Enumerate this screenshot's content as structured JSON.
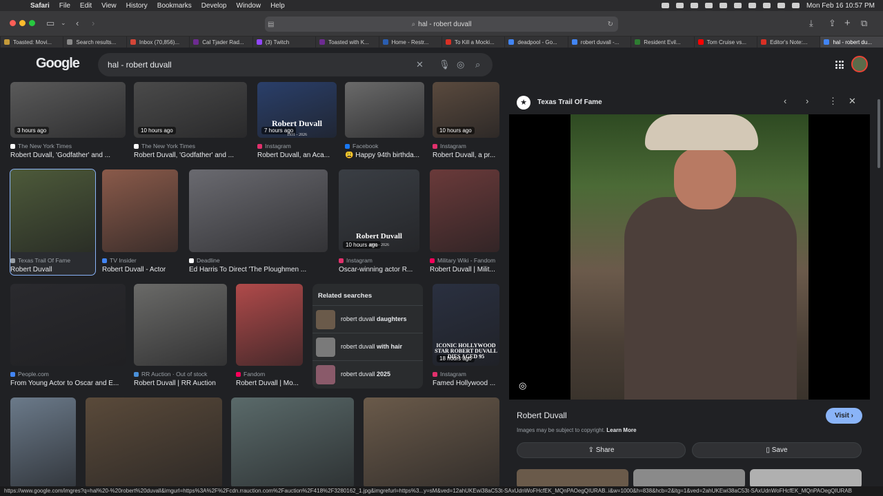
{
  "menubar": {
    "app": "Safari",
    "items": [
      "File",
      "Edit",
      "View",
      "History",
      "Bookmarks",
      "Develop",
      "Window",
      "Help"
    ],
    "datetime": "Mon Feb 16  10:57 PM"
  },
  "browser": {
    "url": "hal - robert duvall",
    "tabs": [
      {
        "label": "Toasted: Movi...",
        "color": "#c49a3a"
      },
      {
        "label": "Search results...",
        "color": "#888"
      },
      {
        "label": "Inbox (70,856)...",
        "color": "#d44638"
      },
      {
        "label": "Cal Tjader Rad...",
        "color": "#6d2b91"
      },
      {
        "label": "(3) Twitch",
        "color": "#9146ff"
      },
      {
        "label": "Toasted with K...",
        "color": "#6d2b91"
      },
      {
        "label": "Home - Restr...",
        "color": "#2a5db0"
      },
      {
        "label": "To Kill a Mocki...",
        "color": "#d93025"
      },
      {
        "label": "deadpool - Go...",
        "color": "#4285f4"
      },
      {
        "label": "robert duvall -...",
        "color": "#4285f4"
      },
      {
        "label": "Resident Evil...",
        "color": "#2e7d32"
      },
      {
        "label": "Tom Cruise vs...",
        "color": "#ff0000"
      },
      {
        "label": "Editor's Note:...",
        "color": "#d93025"
      },
      {
        "label": "hal - robert du...",
        "color": "#4285f4"
      }
    ]
  },
  "google": {
    "logo": "Google",
    "query": "hal - robert duvall"
  },
  "results": [
    {
      "src": "The New York Times",
      "title": "Robert Duvall, 'Godfather' and ...",
      "time": "3 hours ago",
      "color": "#5a5a5a",
      "fav": "#ffffff"
    },
    {
      "src": "The New York Times",
      "title": "Robert Duvall, 'Godfather' and ...",
      "time": "10 hours ago",
      "color": "#4a4a4a",
      "fav": "#ffffff"
    },
    {
      "src": "Instagram",
      "title": "Robert Duvall, an Aca...",
      "time": "7 hours ago",
      "color": "#2a3f6a",
      "fav": "#e1306c"
    },
    {
      "src": "Facebook",
      "title": "😩 Happy 94th birthda...",
      "time": "",
      "color": "#6a6a6a",
      "fav": "#1877f2"
    },
    {
      "src": "Instagram",
      "title": "Robert Duvall, a pr...",
      "time": "10 hours ago",
      "color": "#5a4a3e",
      "fav": "#e1306c"
    },
    {
      "src": "Texas Trail Of Fame",
      "title": "Robert Duvall",
      "time": "",
      "color": "#4d5a3a",
      "fav": "#9aa0a6"
    },
    {
      "src": "TV Insider",
      "title": "Robert Duvall - Actor",
      "time": "",
      "color": "#8a5a4a",
      "fav": "#4285f4"
    },
    {
      "src": "Deadline",
      "title": "Ed Harris To Direct 'The Ploughmen ...",
      "time": "",
      "color": "#6a6a70",
      "fav": "#ffffff"
    },
    {
      "src": "Instagram",
      "title": "Oscar-winning actor R...",
      "time": "10 hours ago",
      "color": "#3a3e44",
      "fav": "#e1306c"
    },
    {
      "src": "Military Wiki - Fandom",
      "title": "Robert Duvall | Milit...",
      "time": "",
      "color": "#6a3a3a",
      "fav": "#fa005a"
    },
    {
      "src": "People.com",
      "title": "From Young Actor to Oscar and E...",
      "time": "",
      "color": "#2a2a2e",
      "fav": "#4285f4"
    },
    {
      "src": "RR Auction · Out of stock",
      "title": "Robert Duvall | RR Auction",
      "time": "",
      "color": "#6a6a68",
      "fav": "#4a90d9"
    },
    {
      "src": "Fandom",
      "title": "Robert Duvall | Mo...",
      "time": "",
      "color": "#b04a4a",
      "fav": "#fa005a"
    },
    {
      "src": "Instagram",
      "title": "Famed Hollywood ...",
      "time": "18 hours ago",
      "color": "#2a3040",
      "fav": "#e1306c"
    },
    {
      "src": "",
      "title": "",
      "time": "",
      "color": "#6b7a8a",
      "fav": "#000"
    },
    {
      "src": "",
      "title": "",
      "time": "",
      "color": "#5a4a3a",
      "fav": "#000"
    },
    {
      "src": "",
      "title": "",
      "time": "",
      "color": "#5a6a6a",
      "fav": "#000"
    },
    {
      "src": "",
      "title": "",
      "time": "",
      "color": "#6a5a4a",
      "fav": "#000"
    }
  ],
  "overlay_texts": {
    "robert_duvall_1": "Robert Duvall",
    "year_1": "1931 - 2026",
    "robert_duvall_2": "Robert Duvall",
    "year_2": "1931 - 2026",
    "iconic": "ICONIC HOLLYWOOD STAR ROBERT DUVALL DIES AGED 95"
  },
  "related": {
    "heading": "Related searches",
    "items": [
      {
        "prefix": "robert duvall ",
        "bold": "daughters",
        "color": "#6a5a4a"
      },
      {
        "prefix": "robert duvall ",
        "bold": "with hair",
        "color": "#7a7a7a"
      },
      {
        "prefix": "robert duvall ",
        "bold": "2025",
        "color": "#8a5a6a"
      }
    ]
  },
  "panel": {
    "source": "Texas Trail Of Fame",
    "title": "Robert Duvall",
    "visit": "Visit",
    "copyright": "Images may be subject to copyright.",
    "learn_more": "Learn More",
    "share": "Share",
    "save": "Save"
  },
  "status_url": "https://www.google.com/imgres?q=hal%20-%20robert%20duvall&imgurl=https%3A%2F%2Fcdn.rrauction.com%2Fauction%2F418%2F3280162_1.jpg&imgrefurl=https%3...y=sM&ved=12ahUKEwi38aC53t-SAxUdnWoFHcfEK_MQnPAOegQIURAB..i&w=1000&h=838&hcb=2&itg=1&ved=2ahUKEwi38aC53t-SAxUdnWoFHcfEK_MQnPAOegQIURAB"
}
